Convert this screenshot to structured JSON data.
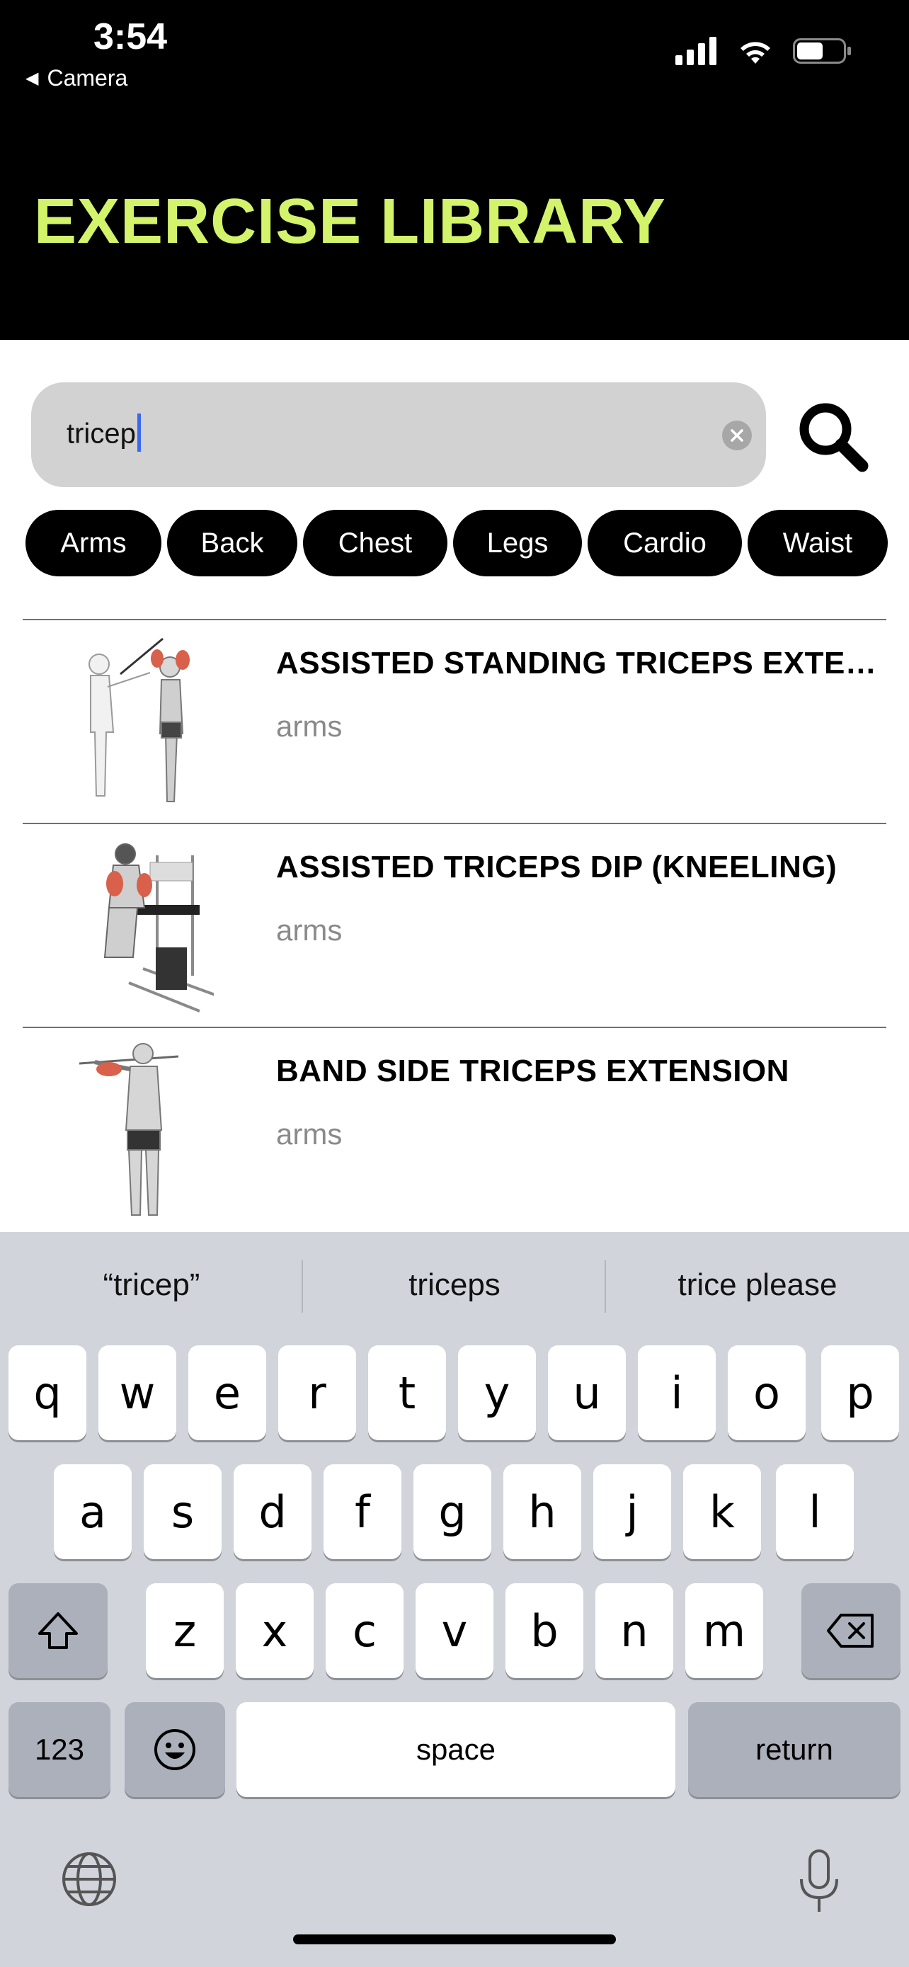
{
  "status_bar": {
    "time": "3:54",
    "back_app": "Camera"
  },
  "header": {
    "title": "EXERCISE LIBRARY",
    "title_color": "#d3f36b"
  },
  "search": {
    "value": "tricep"
  },
  "categories": [
    "Arms",
    "Back",
    "Chest",
    "Legs",
    "Cardio",
    "Waist"
  ],
  "exercises": [
    {
      "title": "ASSISTED STANDING TRICEPS EXTENSION (WITH TOWEL)",
      "category": "arms"
    },
    {
      "title": "ASSISTED TRICEPS DIP (KNEELING)",
      "category": "arms"
    },
    {
      "title": "BAND SIDE TRICEPS EXTENSION",
      "category": "arms"
    }
  ],
  "keyboard": {
    "suggestions": [
      "“tricep”",
      "triceps",
      "trice please"
    ],
    "row1": [
      "q",
      "w",
      "e",
      "r",
      "t",
      "y",
      "u",
      "i",
      "o",
      "p"
    ],
    "row2": [
      "a",
      "s",
      "d",
      "f",
      "g",
      "h",
      "j",
      "k",
      "l"
    ],
    "row3": [
      "z",
      "x",
      "c",
      "v",
      "b",
      "n",
      "m"
    ],
    "numbers_label": "123",
    "space_label": "space",
    "return_label": "return"
  }
}
